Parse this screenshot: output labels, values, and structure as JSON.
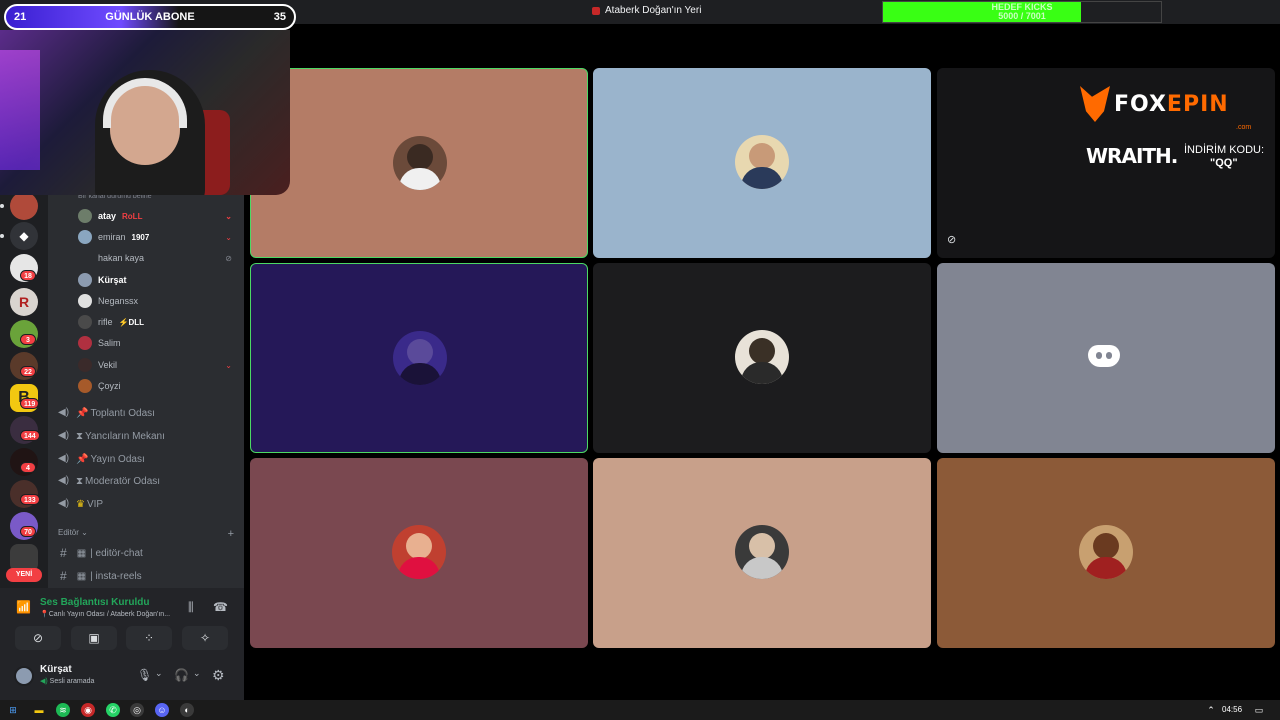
{
  "stream_overlay": {
    "daily_subs_left": "21",
    "daily_subs_title": "GÜNLÜK ABONE",
    "daily_subs_right": "35",
    "kick_goal_title": "HEDEF KICKS",
    "kick_goal_progress": "5000 / 7001",
    "kick_goal_fraction": 0.714
  },
  "window": {
    "server_title": "Ataberk Doğan'ın Yeri"
  },
  "rail": {
    "badges": [
      "18",
      "3",
      "22",
      "119",
      "144",
      "4",
      "133",
      "70"
    ],
    "new_label": "YENİ"
  },
  "channels": {
    "hint": "Bir kanal durumu belirle",
    "members": [
      {
        "name": "atay",
        "tag": "RoLL"
      },
      {
        "name": "emiran",
        "tag": "1907"
      },
      {
        "name": "hakan kaya",
        "tag": ""
      },
      {
        "name": "Kürşat",
        "tag": ""
      },
      {
        "name": "Neganssx",
        "tag": ""
      },
      {
        "name": "rifle",
        "tag": "DLL"
      },
      {
        "name": "Salim",
        "tag": ""
      },
      {
        "name": "Vekil",
        "tag": ""
      },
      {
        "name": "Çoyzi",
        "tag": ""
      }
    ],
    "voice_channels": [
      "Toplantı Odası",
      "Yancıların Mekanı",
      "Yayın Odası",
      "Moderatör Odası",
      "VIP"
    ],
    "category": "Editör",
    "text_channels": [
      "editör-chat",
      "insta-reels"
    ]
  },
  "voice_panel": {
    "status": "Ses Bağlantısı Kuruldu",
    "location": "Canlı Yayın Odası / Ataberk Doğan'ın...",
    "user_name": "Kürşat",
    "user_status": "Sesli aramada"
  },
  "sponsor": {
    "brand_a": "FOX",
    "brand_b": "EPIN",
    "brand_domain": ".com",
    "partner": "WRAITH.",
    "code_label": "İNDİRİM KODU:",
    "code_value": "\"QQ\""
  },
  "taskbar": {
    "time": "04:56"
  },
  "colors": {
    "tile_1": "#b47c66",
    "tile_2": "#9ab4cc",
    "tile_3": "#151517",
    "tile_4": "#251858",
    "tile_5": "#1c1c1e",
    "tile_6": "#818592",
    "tile_7": "#7a4850",
    "tile_8": "#c8a08a",
    "tile_9": "#8c5a38",
    "speaking": "#4cd964"
  }
}
